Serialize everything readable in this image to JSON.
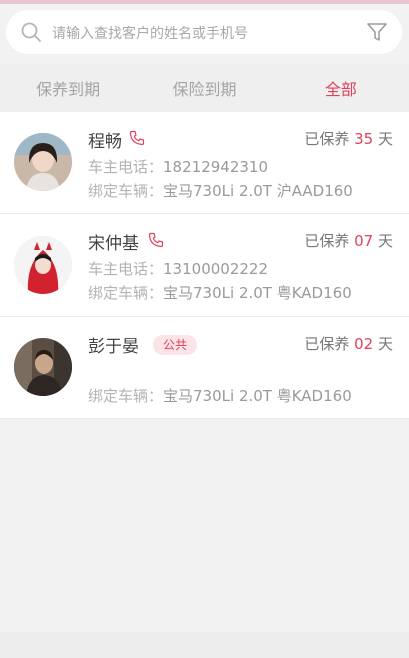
{
  "colors": {
    "accent": "#e0405b",
    "background": "#f2f2f2",
    "card": "#ffffff"
  },
  "search": {
    "placeholder": "请输入查找客户的姓名或手机号",
    "icon": "search-icon",
    "filter_icon": "filter-icon"
  },
  "tabs": [
    {
      "label": "保养到期",
      "active": false
    },
    {
      "label": "保险到期",
      "active": false
    },
    {
      "label": "全部",
      "active": true
    }
  ],
  "customers": [
    {
      "name": "程畅",
      "has_phone_icon": true,
      "status_prefix": "已保养",
      "status_days": "35",
      "status_suffix": "天",
      "phone_label": "车主电话：",
      "phone": "18212942310",
      "vehicle_label": "绑定车辆：",
      "vehicle": "宝马730Li 2.0T 沪AAD160"
    },
    {
      "name": "宋仲基",
      "has_phone_icon": true,
      "status_prefix": "已保养",
      "status_days": "07",
      "status_suffix": "天",
      "phone_label": "车主电话：",
      "phone": "13100002222",
      "vehicle_label": "绑定车辆：",
      "vehicle": "宝马730Li 2.0T 粤KAD160"
    },
    {
      "name": "彭于晏",
      "tag": "公共",
      "status_prefix": "已保养",
      "status_days": "02",
      "status_suffix": "天",
      "vehicle_label": "绑定车辆：",
      "vehicle": "宝马730Li 2.0T 粤KAD160"
    }
  ]
}
